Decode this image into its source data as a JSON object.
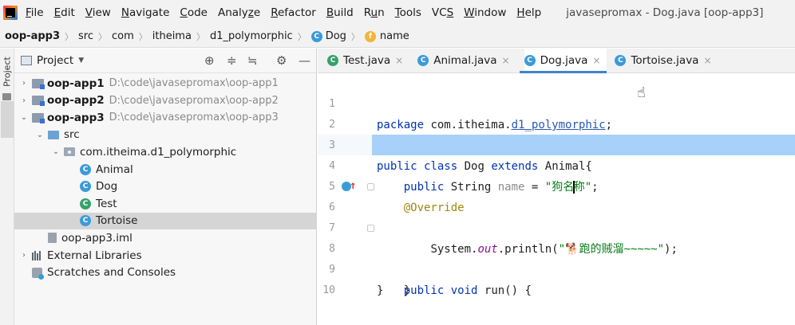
{
  "menu": {
    "items": [
      "File",
      "Edit",
      "View",
      "Navigate",
      "Code",
      "Analyze",
      "Refactor",
      "Build",
      "Run",
      "Tools",
      "VCS",
      "Window",
      "Help"
    ],
    "mnemonics": [
      "F",
      "E",
      "V",
      "N",
      "C",
      "z",
      "R",
      "B",
      "u",
      "T",
      "S",
      "W",
      "H"
    ],
    "window_title": "javasepromax - Dog.java [oop-app3]"
  },
  "breadcrumb": {
    "items": [
      "oop-app3",
      "src",
      "com",
      "itheima",
      "d1_polymorphic",
      "Dog",
      "name"
    ],
    "class_icon": "C",
    "field_icon": "f"
  },
  "side_stripe": {
    "label": "Project"
  },
  "project_panel": {
    "title": "Project",
    "tools": [
      "locate-icon",
      "expand-all-icon",
      "collapse-all-icon",
      "gear-icon",
      "hide-icon"
    ],
    "tree": [
      {
        "label": "oop-app1",
        "path": "D:\\code\\javasepromax\\oop-app1",
        "type": "module",
        "expanded": false
      },
      {
        "label": "oop-app2",
        "path": "D:\\code\\javasepromax\\oop-app2",
        "type": "module",
        "expanded": false
      },
      {
        "label": "oop-app3",
        "path": "D:\\code\\javasepromax\\oop-app3",
        "type": "module",
        "expanded": true
      },
      {
        "label": "src",
        "type": "source-folder",
        "expanded": true
      },
      {
        "label": "com.itheima.d1_polymorphic",
        "type": "package",
        "expanded": true
      },
      {
        "label": "Animal",
        "type": "class"
      },
      {
        "label": "Dog",
        "type": "class"
      },
      {
        "label": "Test",
        "type": "runnable-class"
      },
      {
        "label": "Tortoise",
        "type": "class",
        "selected": true
      },
      {
        "label": "oop-app3.iml",
        "type": "iml"
      },
      {
        "label": "External Libraries",
        "type": "libraries",
        "expanded": false
      },
      {
        "label": "Scratches and Consoles",
        "type": "scratches"
      }
    ]
  },
  "editor_tabs": [
    {
      "label": "Test.java",
      "icon": "runnable-class-icon",
      "active": false
    },
    {
      "label": "Animal.java",
      "icon": "class-icon",
      "active": false
    },
    {
      "label": "Dog.java",
      "icon": "class-icon",
      "active": true
    },
    {
      "label": "Tortoise.java",
      "icon": "class-icon",
      "active": false
    }
  ],
  "tab_close": "×",
  "code": {
    "line_numbers": [
      "1",
      "2",
      "3",
      "4",
      "5",
      "6",
      "7",
      "8",
      "9",
      "10"
    ],
    "l1_kw": "package",
    "l1_pkg": "com.itheima.",
    "l1_link": "d1_polymorphic",
    "l1_semi": ";",
    "l3_kw1": "public",
    "l3_kw2": "class",
    "l3_name": "Dog",
    "l3_kw3": "extends",
    "l3_rest": "Animal{",
    "l4_kw": "public",
    "l4_type": "String",
    "l4_field": "name",
    "l4_eq": "=",
    "l4_str_a": "\"狗名",
    "l4_str_b": "称\"",
    "l4_semi": ";",
    "l5_ann": "@Override",
    "l6_kw1": "public",
    "l6_kw2": "void",
    "l6_rest": "run() {",
    "l7_a": "System.",
    "l7_static": "out",
    "l7_b": ".println(",
    "l7_str": "\"🐕跑的贼溜~~~~~\"",
    "l7_c": ");",
    "l8": "}",
    "l9": "}",
    "gutter_override_arrow": "↑"
  }
}
